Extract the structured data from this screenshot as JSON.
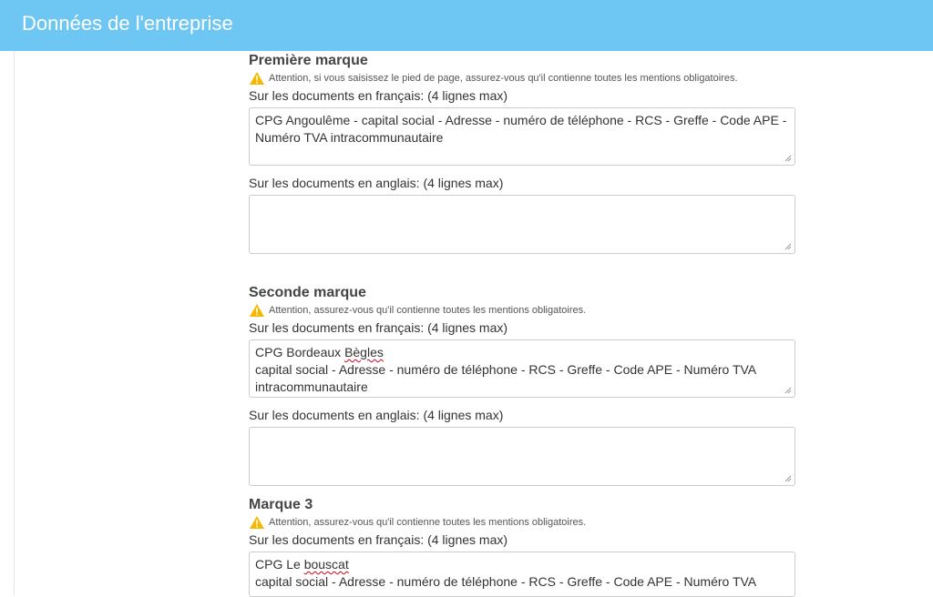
{
  "header": {
    "title": "Données de l'entreprise"
  },
  "colors": {
    "header_bg": "#6ec6f2",
    "warning": "#f5b800"
  },
  "sections": [
    {
      "title": "Première marque",
      "warning": "Attention, si vous saisissez le pied de page, assurez-vous qu'il contienne toutes les mentions obligatoires.",
      "fr_label": "Sur les documents en français: (4 lignes max)",
      "fr_value_lines": [
        "CPG Angoulême - capital social - Adresse - numéro de téléphone - RCS - Greffe - Code APE -",
        "Numéro TVA intracommunautaire"
      ],
      "en_label": "Sur les documents en anglais: (4 lignes max)",
      "en_value": ""
    },
    {
      "title": "Seconde marque",
      "warning": "Attention, assurez-vous qu'il contienne toutes les mentions obligatoires.",
      "fr_label": "Sur les documents en français: (4 lignes max)",
      "fr_value_lines": [
        "CPG Bordeaux ",
        "Bègles",
        "capital social - Adresse - numéro de téléphone - RCS - Greffe - Code APE - Numéro TVA",
        "intracommunautaire"
      ],
      "en_label": "Sur les documents en anglais: (4 lignes max)",
      "en_value": ""
    },
    {
      "title": "Marque 3",
      "warning": "Attention, assurez-vous qu'il contienne toutes les mentions obligatoires.",
      "fr_label": "Sur les documents en français: (4 lignes max)",
      "fr_value_lines": [
        "CPG Le ",
        "bouscat",
        "capital social - Adresse - numéro de téléphone - RCS - Greffe - Code APE - Numéro TVA"
      ]
    }
  ],
  "icons": {
    "warning": "warning-triangle-icon",
    "resize": "resize-grip-icon"
  }
}
